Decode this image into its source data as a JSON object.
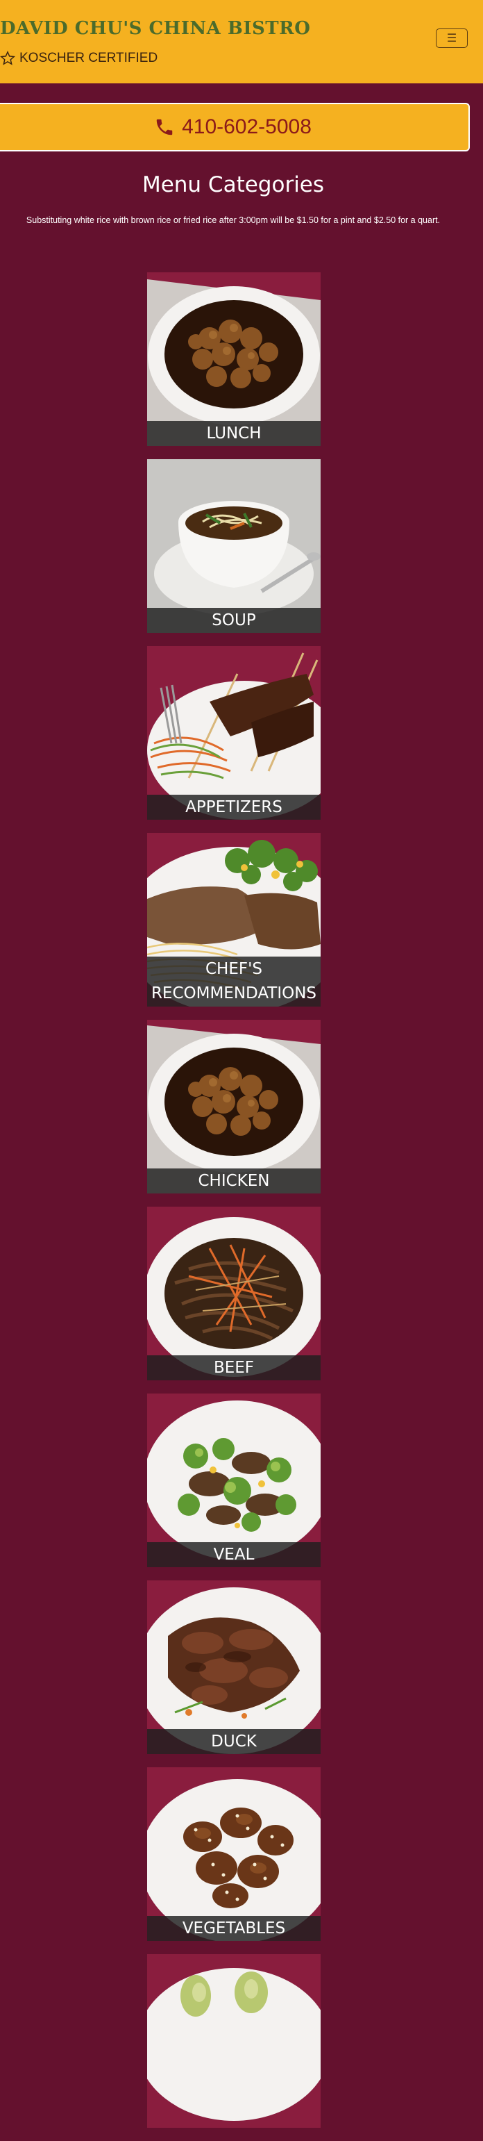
{
  "header": {
    "brand": "DAVID CHU'S CHINA BISTRO",
    "kosher": "KOSCHER CERTIFIED",
    "menu_toggle_icon": "hamburger-icon"
  },
  "phone": {
    "number": "410-602-5008",
    "icon": "phone-icon"
  },
  "main": {
    "title": "Menu Categories",
    "note": "Substituting white rice with brown rice or fried rice after 3:00pm will be $1.50 for a pint and $2.50 for a quart."
  },
  "categories": [
    {
      "label": "LUNCH",
      "dish": "sauce-chicken"
    },
    {
      "label": "SOUP",
      "dish": "soup"
    },
    {
      "label": "APPETIZERS",
      "dish": "skewers"
    },
    {
      "label": "CHEF'S RECOMMENDATIONS",
      "dish": "plate-combo"
    },
    {
      "label": "CHICKEN",
      "dish": "sauce-chicken"
    },
    {
      "label": "BEEF",
      "dish": "beef-strips"
    },
    {
      "label": "VEAL",
      "dish": "broccoli-veal"
    },
    {
      "label": "DUCK",
      "dish": "duck"
    },
    {
      "label": "VEGETABLES",
      "dish": "sesame"
    },
    {
      "label": "",
      "dish": "greens"
    }
  ],
  "colors": {
    "background": "#64112e",
    "header": "#f5b120",
    "brand_text": "#4b6b2b",
    "phone_text": "#8b1a1a"
  }
}
